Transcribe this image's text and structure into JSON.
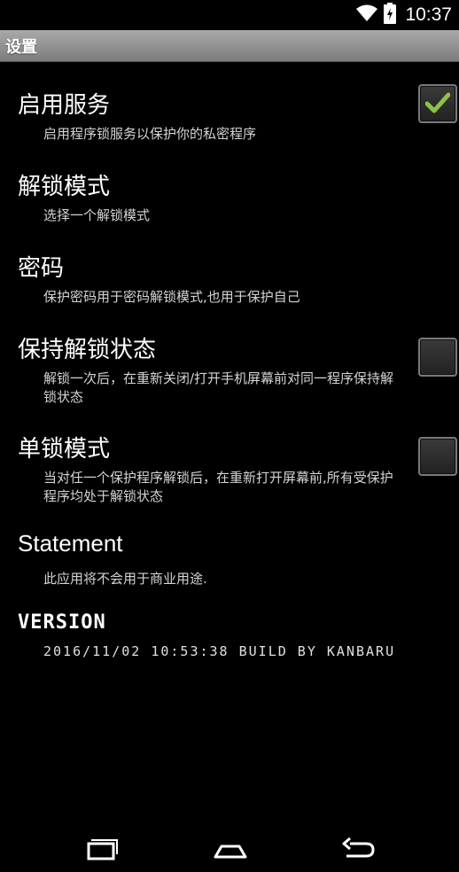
{
  "status_bar": {
    "time": "10:37",
    "icons": [
      "wifi-icon",
      "battery-icon"
    ]
  },
  "title_bar": {
    "title": "设置"
  },
  "preferences": [
    {
      "title": "启用服务",
      "summary": "启用程序锁服务以保护你的私密程序",
      "has_checkbox": true,
      "checked": true
    },
    {
      "title": "解锁模式",
      "summary": "选择一个解锁模式",
      "has_checkbox": false
    },
    {
      "title": "密码",
      "summary": "保护密码用于密码解锁模式,也用于保护自己",
      "has_checkbox": false
    },
    {
      "title": "保持解锁状态",
      "summary": "解锁一次后，在重新关闭/打开手机屏幕前对同一程序保持解锁状态",
      "has_checkbox": true,
      "checked": false
    },
    {
      "title": "单锁模式",
      "summary": "当对任一个保护程序解锁后，在重新打开屏幕前,所有受保护程序均处于解锁状态",
      "has_checkbox": true,
      "checked": false
    },
    {
      "title": "Statement",
      "summary": "此应用将不会用于商业用途.",
      "has_checkbox": false
    }
  ],
  "version": {
    "title": "VERSION",
    "build": "2016/11/02 10:53:38 BUILD BY KANBARU"
  },
  "nav_bar": {
    "icons": [
      "recent-apps-icon",
      "home-icon",
      "back-icon"
    ]
  },
  "colors": {
    "background": "#000000",
    "title_bar": "#8f8f8f",
    "check_accent": "#8bc34a",
    "summary_text": "#d4d4d4"
  }
}
